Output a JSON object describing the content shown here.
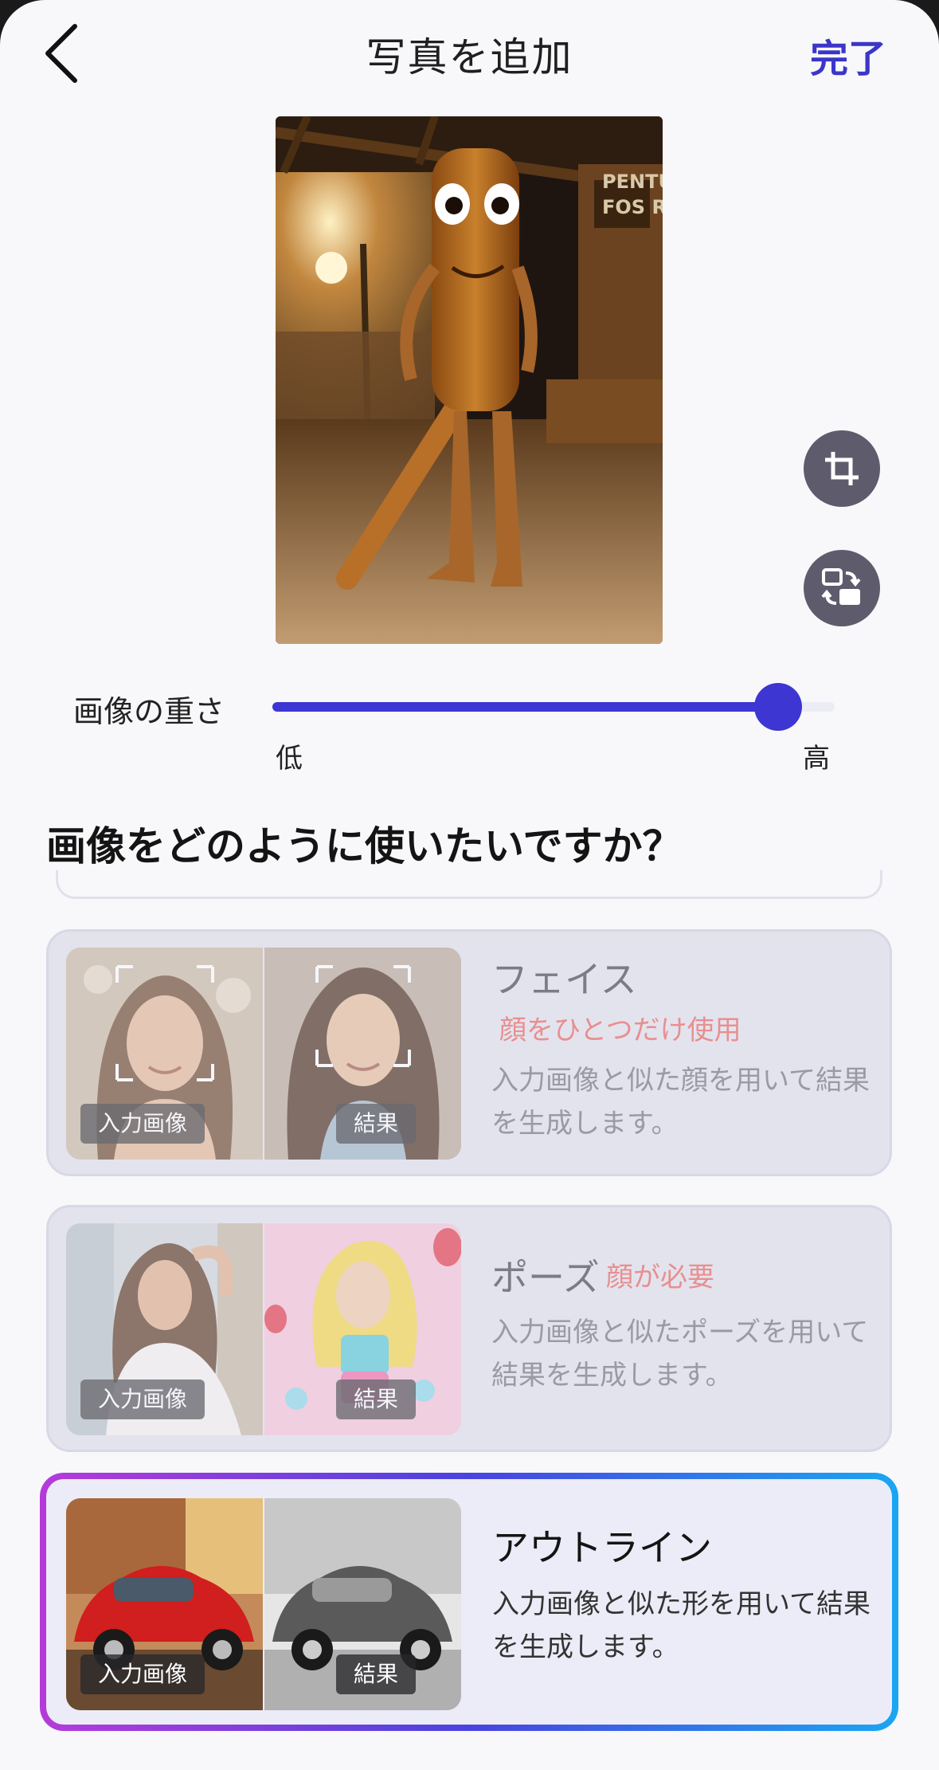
{
  "header": {
    "title": "写真を追加",
    "done_label": "完了"
  },
  "slider": {
    "label": "画像の重さ",
    "min_label": "低",
    "max_label": "高",
    "value": 0.9
  },
  "section": {
    "title": "画像をどのように使いたいですか？"
  },
  "options": [
    {
      "name": "フェイス",
      "note": "顔をひとつだけ使用",
      "description": "入力画像と似た顔を用いて結果を生成します。",
      "input_tag": "入力画像",
      "result_tag": "結果",
      "selected": false
    },
    {
      "name": "ポーズ",
      "note": "顔が必要",
      "description": "入力画像と似たポーズを用いて結果を生成します。",
      "input_tag": "入力画像",
      "result_tag": "結果",
      "selected": false
    },
    {
      "name": "アウトライン",
      "note": "",
      "description": "入力画像と似た形を用いて結果を生成します。",
      "input_tag": "入力画像",
      "result_tag": "結果",
      "selected": true
    }
  ],
  "colors": {
    "accent": "#3d36d2",
    "note": "#e88f8f",
    "gradient": [
      "#b53bd9",
      "#4a43e0",
      "#1aa6f2"
    ]
  },
  "icons": {
    "back": "chevron-left-icon",
    "crop": "crop-icon",
    "swap": "swap-image-icon"
  }
}
